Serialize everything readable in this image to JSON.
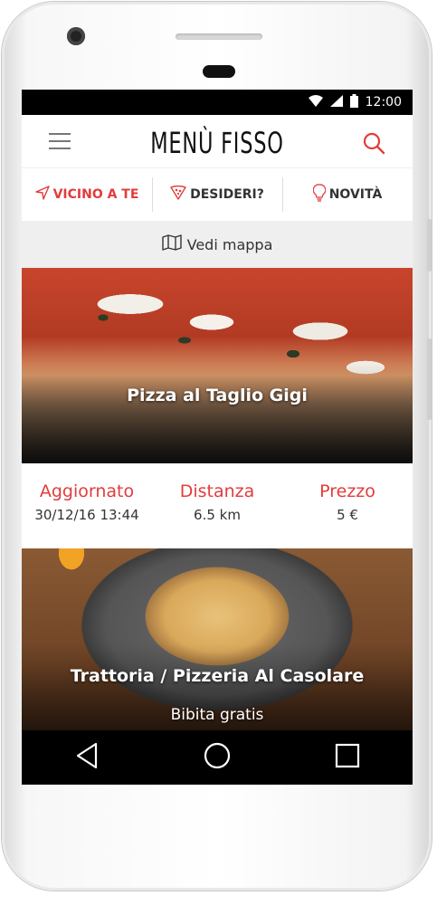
{
  "status_bar": {
    "time": "12:00"
  },
  "app": {
    "logo_text": "MENÙ FISSO"
  },
  "tabs": [
    {
      "label": "VICINO A TE",
      "icon": "navigation-arrow-icon",
      "active": true
    },
    {
      "label": "DESIDERI?",
      "icon": "pizza-slice-icon",
      "active": false
    },
    {
      "label": "NOVITÀ",
      "icon": "lightbulb-icon",
      "active": false
    }
  ],
  "map_bar": {
    "label": "Vedi mappa",
    "icon": "map-icon"
  },
  "cards": [
    {
      "title": "Pizza al Taglio Gigi",
      "stats": [
        {
          "label": "Aggiornato",
          "value": "30/12/16 13:44"
        },
        {
          "label": "Distanza",
          "value": "6.5 km"
        },
        {
          "label": "Prezzo",
          "value": "5 €"
        }
      ]
    },
    {
      "title": "Trattoria / Pizzeria Al Casolare",
      "subtitle": "Bibita gratis"
    }
  ],
  "colors": {
    "accent": "#e23c3c",
    "statusbar": "#000000",
    "text": "#333333"
  }
}
